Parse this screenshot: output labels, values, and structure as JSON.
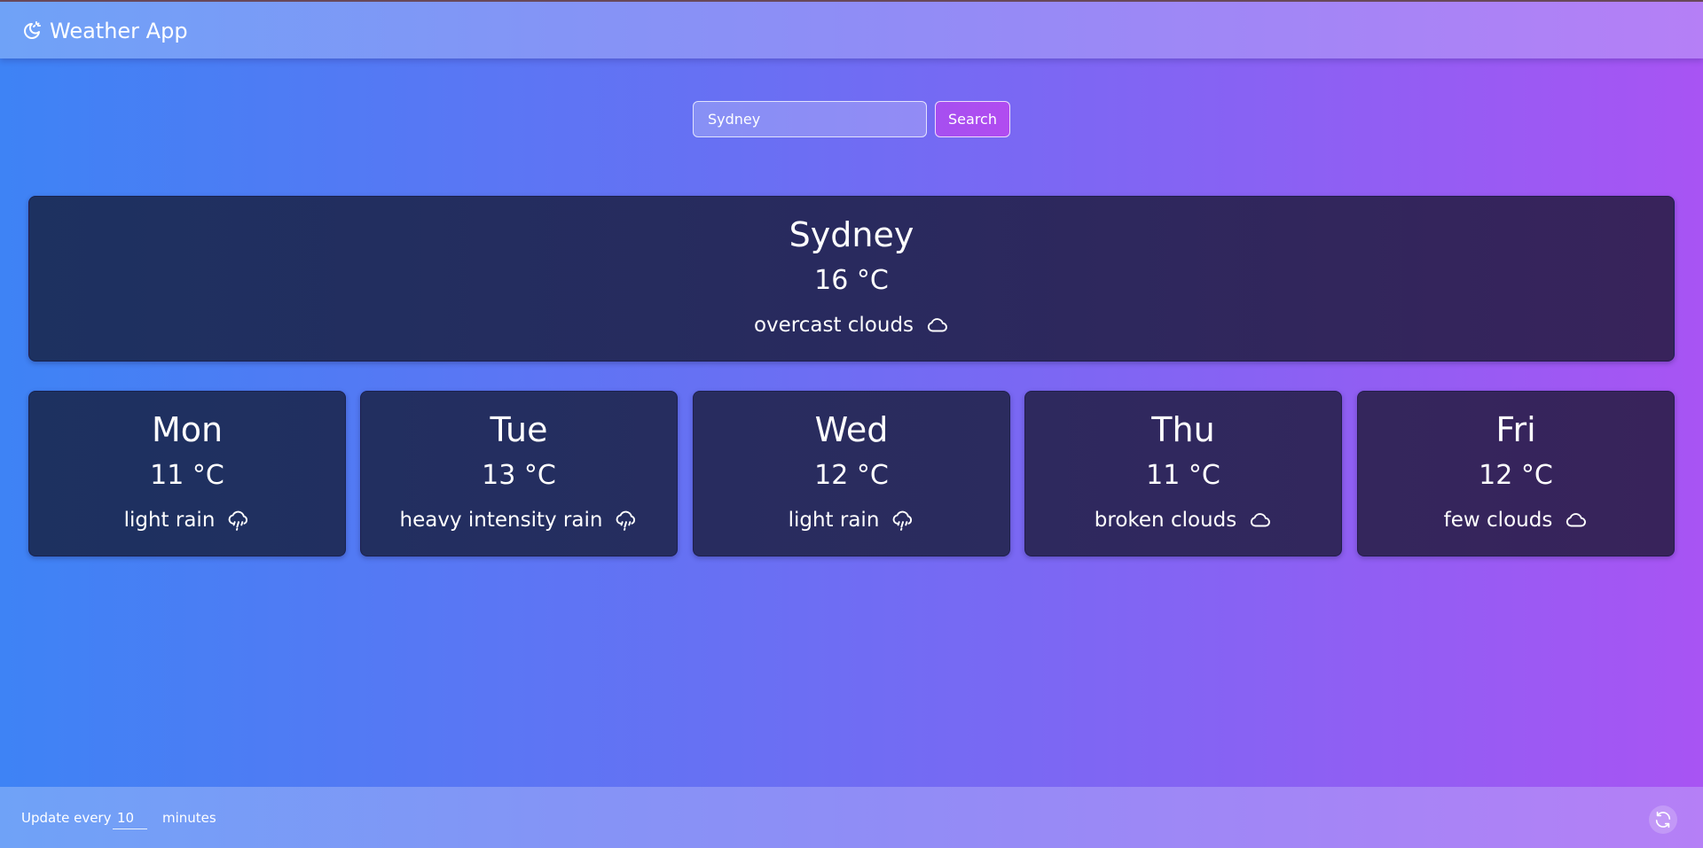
{
  "header": {
    "title": "Weather App",
    "logo_icon": "sun-moon-icon"
  },
  "search": {
    "value": "Sydney",
    "button_label": "Search"
  },
  "current": {
    "city": "Sydney",
    "temperature": "16 °C",
    "description": "overcast clouds",
    "icon": "cloud-icon"
  },
  "forecast": [
    {
      "day": "Mon",
      "temperature": "11 °C",
      "description": "light rain",
      "icon": "rain-icon"
    },
    {
      "day": "Tue",
      "temperature": "13 °C",
      "description": "heavy intensity rain",
      "icon": "rain-icon"
    },
    {
      "day": "Wed",
      "temperature": "12 °C",
      "description": "light rain",
      "icon": "rain-icon"
    },
    {
      "day": "Thu",
      "temperature": "11 °C",
      "description": "broken clouds",
      "icon": "cloud-icon"
    },
    {
      "day": "Fri",
      "temperature": "12 °C",
      "description": "few clouds",
      "icon": "cloud-icon"
    }
  ],
  "footer": {
    "label_before": "Update every",
    "interval_value": "10",
    "label_after": "minutes",
    "refresh_icon": "refresh-icon"
  },
  "colors": {
    "background_start": "#3e83f5",
    "background_end": "#a854f3",
    "card_start": "#1d3160",
    "card_end": "#38235b",
    "search_button": "#a64ff0",
    "text": "#ffffff"
  }
}
